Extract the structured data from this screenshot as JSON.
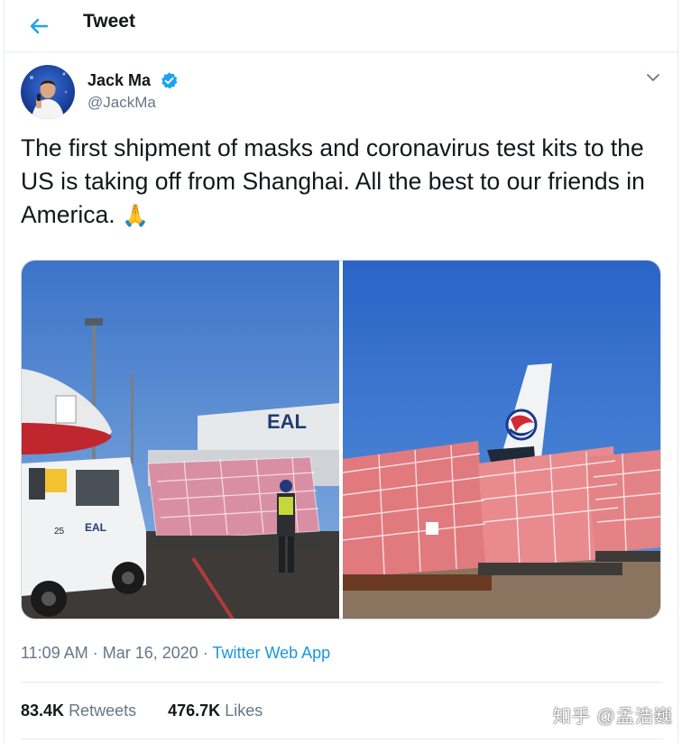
{
  "header": {
    "title": "Tweet",
    "back_icon": "arrow-left-icon"
  },
  "author": {
    "name": "Jack Ma",
    "handle": "@JackMa",
    "verified": true
  },
  "tweet": {
    "text": "The first shipment of masks and coronavirus test kits to the US is taking off from Shanghai. All the best to our friends in America.",
    "emoji": "🙏"
  },
  "media": {
    "left_sign": "EAL",
    "left_vehicle_sign": "EAL",
    "left_vehicle_number": "25"
  },
  "meta": {
    "time": "11:09 AM",
    "sep1": " · ",
    "date": "Mar 16, 2020",
    "sep2": " · ",
    "source": "Twitter Web App"
  },
  "stats": {
    "retweets_count": "83.4K",
    "retweets_label": "Retweets",
    "likes_count": "476.7K",
    "likes_label": "Likes"
  },
  "watermark": "知乎 @孟浩巍",
  "colors": {
    "accent": "#1da1f2",
    "text": "#14171a",
    "muted": "#657786"
  }
}
